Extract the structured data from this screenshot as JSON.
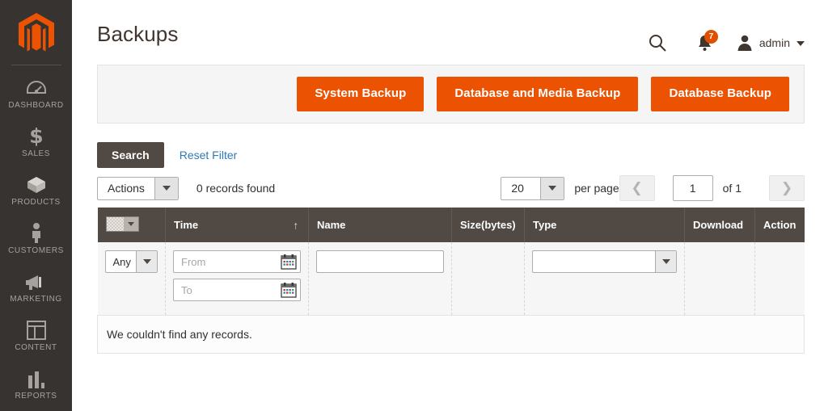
{
  "sidebar": {
    "logo_name": "magento-logo",
    "items": [
      {
        "label": "DASHBOARD",
        "icon": "dashboard-icon"
      },
      {
        "label": "SALES",
        "icon": "dollar-icon"
      },
      {
        "label": "PRODUCTS",
        "icon": "box-icon"
      },
      {
        "label": "CUSTOMERS",
        "icon": "person-icon"
      },
      {
        "label": "MARKETING",
        "icon": "megaphone-icon"
      },
      {
        "label": "CONTENT",
        "icon": "layout-icon"
      },
      {
        "label": "REPORTS",
        "icon": "bar-chart-icon"
      }
    ]
  },
  "header": {
    "title": "Backups",
    "search_icon": "search-icon",
    "notifications_icon": "bell-icon",
    "notifications_count": "7",
    "avatar_icon": "user-avatar-icon",
    "admin_label": "admin",
    "caret_icon": "chevron-down-icon"
  },
  "button_bar": {
    "system_backup": "System Backup",
    "database_and_media_backup": "Database and Media Backup",
    "database_backup": "Database Backup"
  },
  "search_row": {
    "search_label": "Search",
    "reset_filter_label": "Reset Filter"
  },
  "controls": {
    "actions_label": "Actions",
    "records_found": "0 records found",
    "per_page_value": "20",
    "per_page_label": "per page",
    "prev_icon": "chevron-left-icon",
    "next_icon": "chevron-right-icon",
    "page_value": "1",
    "of_label": "of 1"
  },
  "grid": {
    "columns": [
      {
        "label": "",
        "name": "select-all"
      },
      {
        "label": "Time",
        "name": "time",
        "sort": "asc",
        "sort_icon": "arrow-up-icon"
      },
      {
        "label": "Name",
        "name": "name"
      },
      {
        "label": "Size(bytes)",
        "name": "size-bytes"
      },
      {
        "label": "Type",
        "name": "type"
      },
      {
        "label": "Download",
        "name": "download"
      },
      {
        "label": "Action",
        "name": "action"
      }
    ],
    "filters": {
      "select_all_value": "Any",
      "time_from_placeholder": "From",
      "time_from_value": "",
      "time_to_placeholder": "To",
      "time_to_value": "",
      "name_value": "",
      "type_value": "",
      "calendar_icon": "calendar-icon"
    },
    "rows": [],
    "empty_message": "We couldn't find any records."
  },
  "colors": {
    "accent_orange": "#eb5202",
    "sidebar_bg": "#373330",
    "header_dark": "#514943",
    "link_blue": "#2f7ab4",
    "badge_red": "#e04f00"
  }
}
